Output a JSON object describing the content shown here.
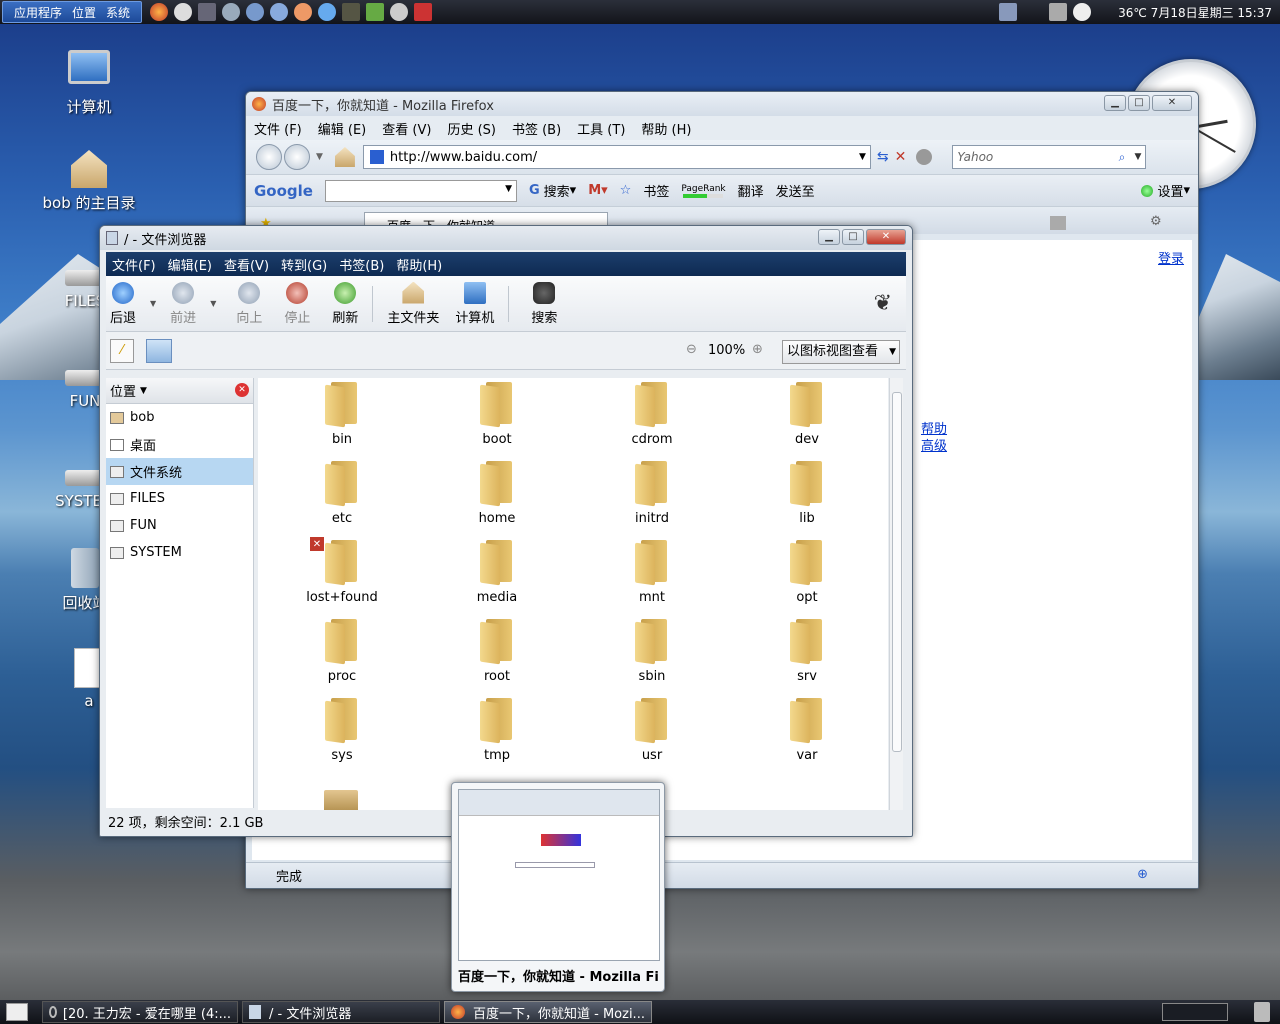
{
  "top_panel": {
    "menus": [
      "应用程序",
      "位置",
      "系统"
    ],
    "clock_text": "36℃ 7月18日星期三 15:37"
  },
  "desktop": {
    "icons": [
      {
        "label": "计算机"
      },
      {
        "label": "bob 的主目录"
      },
      {
        "label": "FILES"
      },
      {
        "label": "FUN"
      },
      {
        "label": "SYSTEM"
      },
      {
        "label": "回收站"
      },
      {
        "label": "a"
      }
    ]
  },
  "firefox": {
    "title": "百度一下，你就知道 - Mozilla Firefox",
    "menus": [
      "文件 (F)",
      "编辑 (E)",
      "查看 (V)",
      "历史 (S)",
      "书签 (B)",
      "工具 (T)",
      "帮助 (H)"
    ],
    "url": "http://www.baidu.com/",
    "search_placeholder": "Yahoo",
    "google_toolbar": {
      "logo": "Google",
      "search_label": "搜索",
      "bookmarks_label": "书签",
      "pagerank_label": "PageRank",
      "translate_label": "翻译",
      "sendto_label": "发送至",
      "settings_label": "设置"
    },
    "tab_title": "百度一下，你就知道",
    "page_links": {
      "login": "登录",
      "help": "帮助",
      "advanced": "高级"
    },
    "status": "完成"
  },
  "nautilus": {
    "title": "/ - 文件浏览器",
    "menus": [
      "文件(F)",
      "编辑(E)",
      "查看(V)",
      "转到(G)",
      "书签(B)",
      "帮助(H)"
    ],
    "toolbar": {
      "back": "后退",
      "forward": "前进",
      "up": "向上",
      "stop": "停止",
      "reload": "刷新",
      "home": "主文件夹",
      "computer": "计算机",
      "search": "搜索"
    },
    "zoom": "100%",
    "view_mode": "以图标视图查看",
    "sidebar": {
      "header": "位置",
      "items": [
        "bob",
        "桌面",
        "文件系统",
        "FILES",
        "FUN",
        "SYSTEM"
      ]
    },
    "folders": [
      "bin",
      "boot",
      "cdrom",
      "dev",
      "etc",
      "home",
      "initrd",
      "lib",
      "lost+found",
      "media",
      "mnt",
      "opt",
      "proc",
      "root",
      "sbin",
      "srv",
      "sys",
      "tmp",
      "usr",
      "var"
    ],
    "status": "22 项，剩余空间：2.1 GB"
  },
  "preview": {
    "title": "百度一下，你就知道 - Mozilla Fi..."
  },
  "taskbar": {
    "tasks": [
      "[20. 王力宏 - 爱在哪里 (4:...",
      "/ - 文件浏览器",
      "百度一下，你就知道 - Mozi..."
    ]
  }
}
